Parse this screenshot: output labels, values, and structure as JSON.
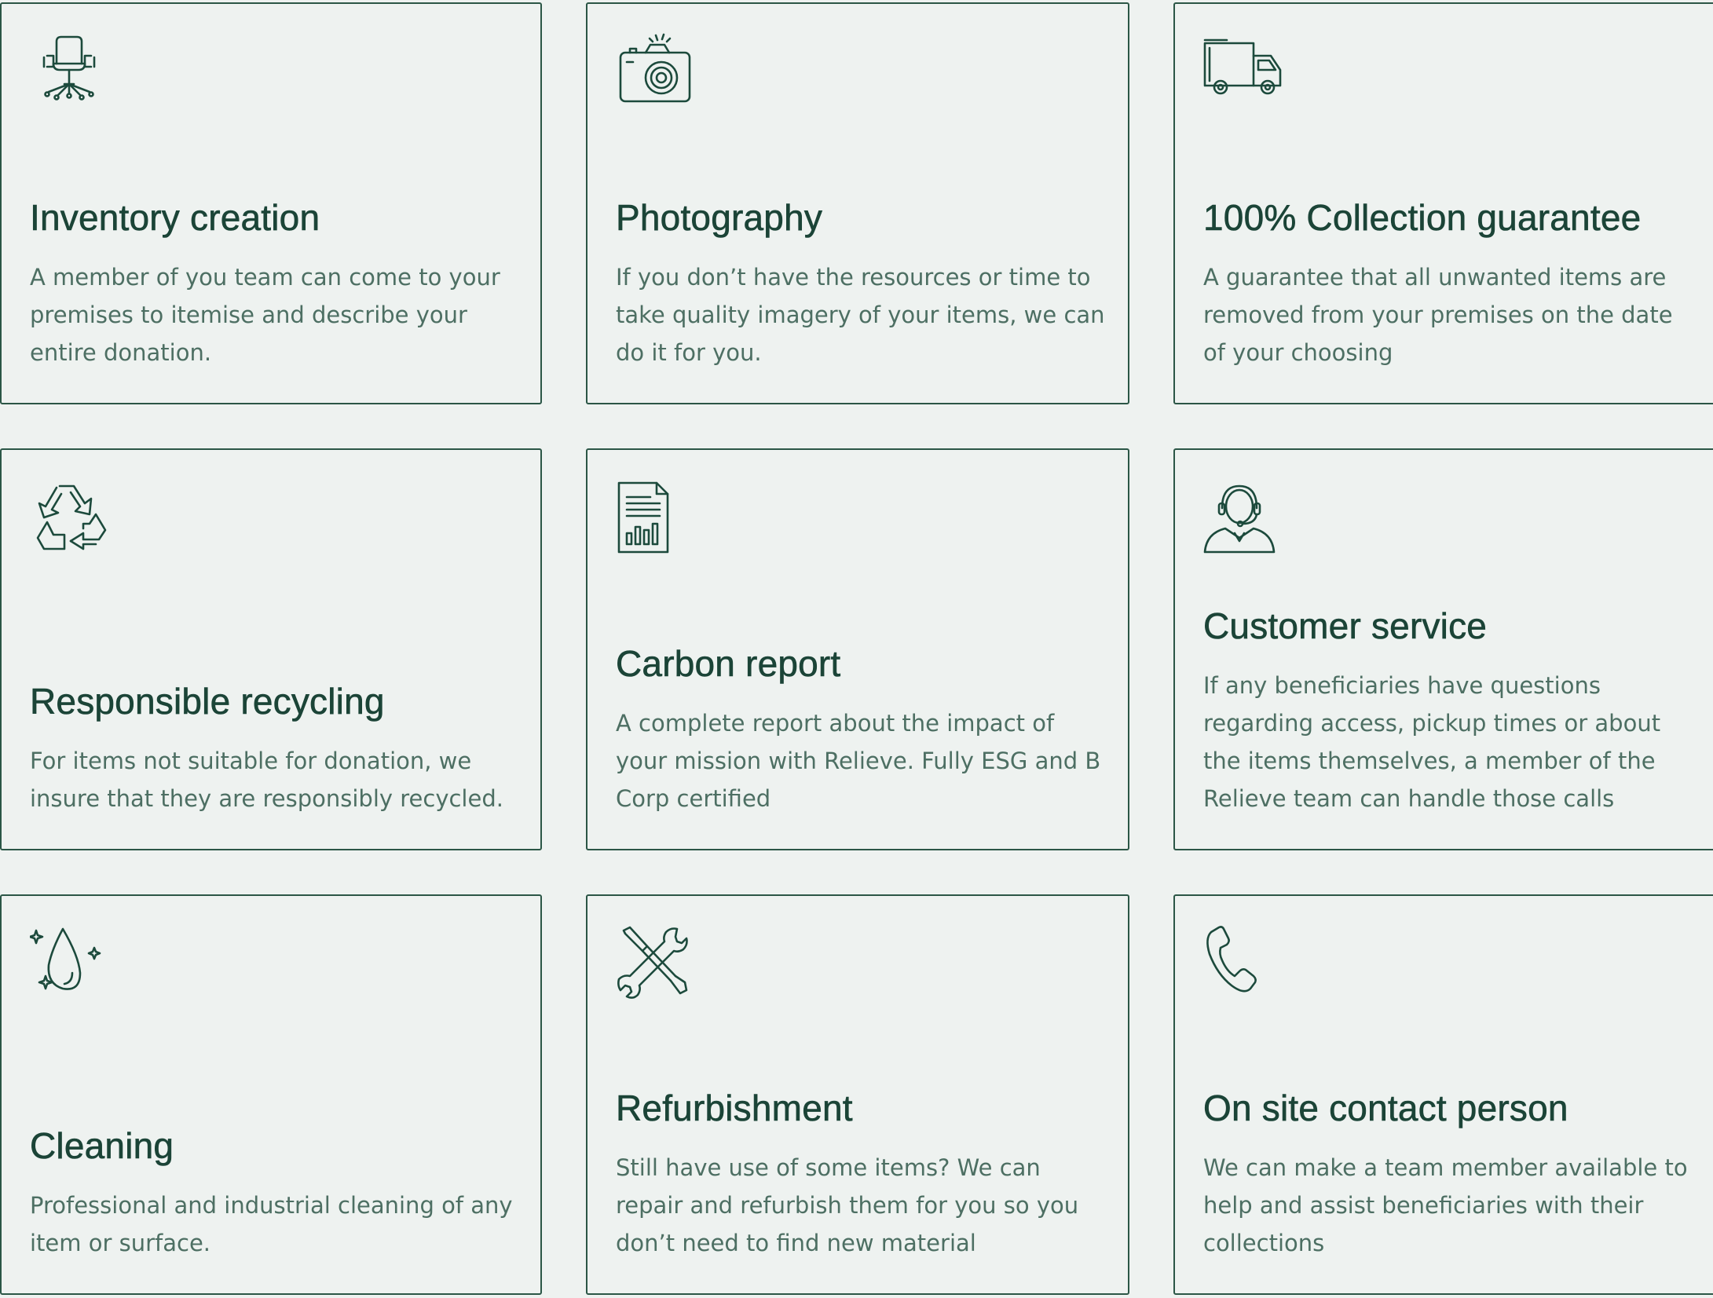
{
  "theme": {
    "background": "#eef2f0",
    "border": "#2b5646",
    "heading": "#1b4437",
    "body_text": "#4d6f63"
  },
  "cards": [
    {
      "icon": "office-chair-icon",
      "title": "Inventory creation",
      "description": "A member of you team can come to your premises to itemise and describe your entire donation."
    },
    {
      "icon": "camera-icon",
      "title": "Photography",
      "description": "If you don’t have the resources or time to take quality imagery of your items, we can do it for you."
    },
    {
      "icon": "delivery-truck-icon",
      "title": "100% Collection guarantee",
      "description": "A guarantee that all unwanted items are removed from your premises on the date of your choosing"
    },
    {
      "icon": "recycle-icon",
      "title": "Responsible recycling",
      "description": "For items not suitable for donation, we insure that they are responsibly recycled."
    },
    {
      "icon": "report-document-icon",
      "title": "Carbon report",
      "description": "A complete report about the impact of your mission with Relieve. Fully ESG and B Corp certified"
    },
    {
      "icon": "customer-service-headset-icon",
      "title": "Customer service",
      "description": "If any beneficiaries have questions regarding access, pickup times or about the items themselves, a member of the Relieve team can handle those calls"
    },
    {
      "icon": "sparkling-drop-icon",
      "title": "Cleaning",
      "description": "Professional and industrial cleaning of any item or surface."
    },
    {
      "icon": "wrench-screwdriver-icon",
      "title": "Refurbishment",
      "description": "Still have use of some items? We can repair and refurbish them for you so you don’t need to find new material"
    },
    {
      "icon": "phone-icon",
      "title": "On site contact person",
      "description": "We can make a team member available to help and assist beneficiaries with their collections"
    }
  ]
}
